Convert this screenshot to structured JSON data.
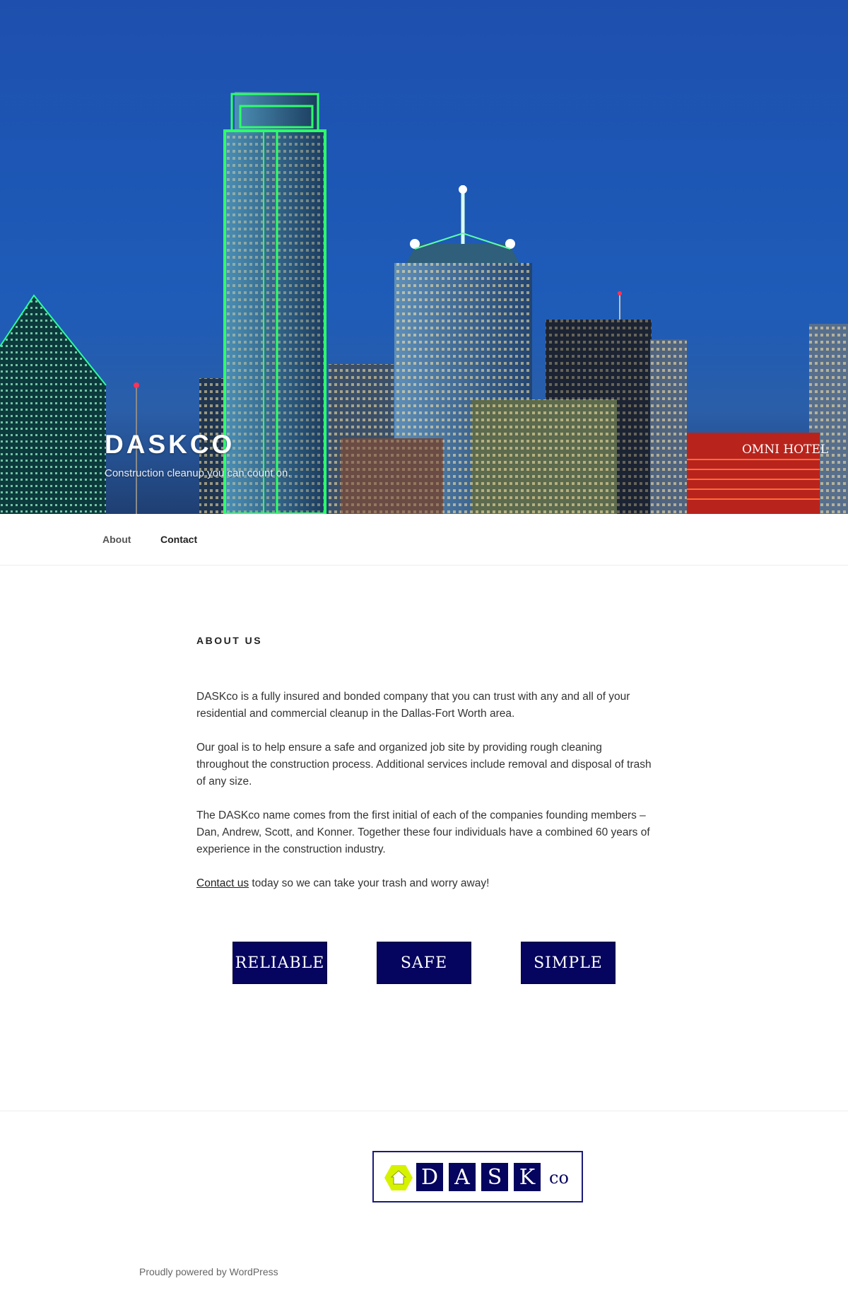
{
  "site": {
    "title": "DASKCO",
    "description": "Construction cleanup you can count on."
  },
  "navigation": {
    "items": [
      {
        "label": "About"
      },
      {
        "label": "Contact"
      }
    ]
  },
  "page": {
    "title": "ABOUT US",
    "paragraphs": [
      "DASKco is a fully insured and bonded company that you can trust with any and all of your residential and commercial cleanup in the Dallas-Fort Worth area.",
      "Our goal is to help ensure a safe and organized job site by providing rough cleaning throughout the construction process. Additional services include removal and disposal of trash of any size.",
      "The DASKco name comes from the first initial of each of the companies founding members – Dan, Andrew, Scott, and Konner. Together these four individuals have a combined 60 years of experience in the construction industry."
    ],
    "cta": {
      "link_text": "Contact us",
      "rest": " today so we can take your trash and worry away!"
    }
  },
  "values": [
    "RELIABLE",
    "SAFE",
    "SIMPLE"
  ],
  "hero_image": {
    "sign_text": "OMNI HOTEL"
  },
  "footer": {
    "logo": {
      "letters": [
        "D",
        "A",
        "S",
        "K"
      ],
      "suffix": "co"
    },
    "powered_by": "Proudly powered by WordPress"
  },
  "colors": {
    "brand_navy": "#05045e",
    "logo_hex_yellow": "#d7f200",
    "sky_blue": "#1e56b2"
  }
}
